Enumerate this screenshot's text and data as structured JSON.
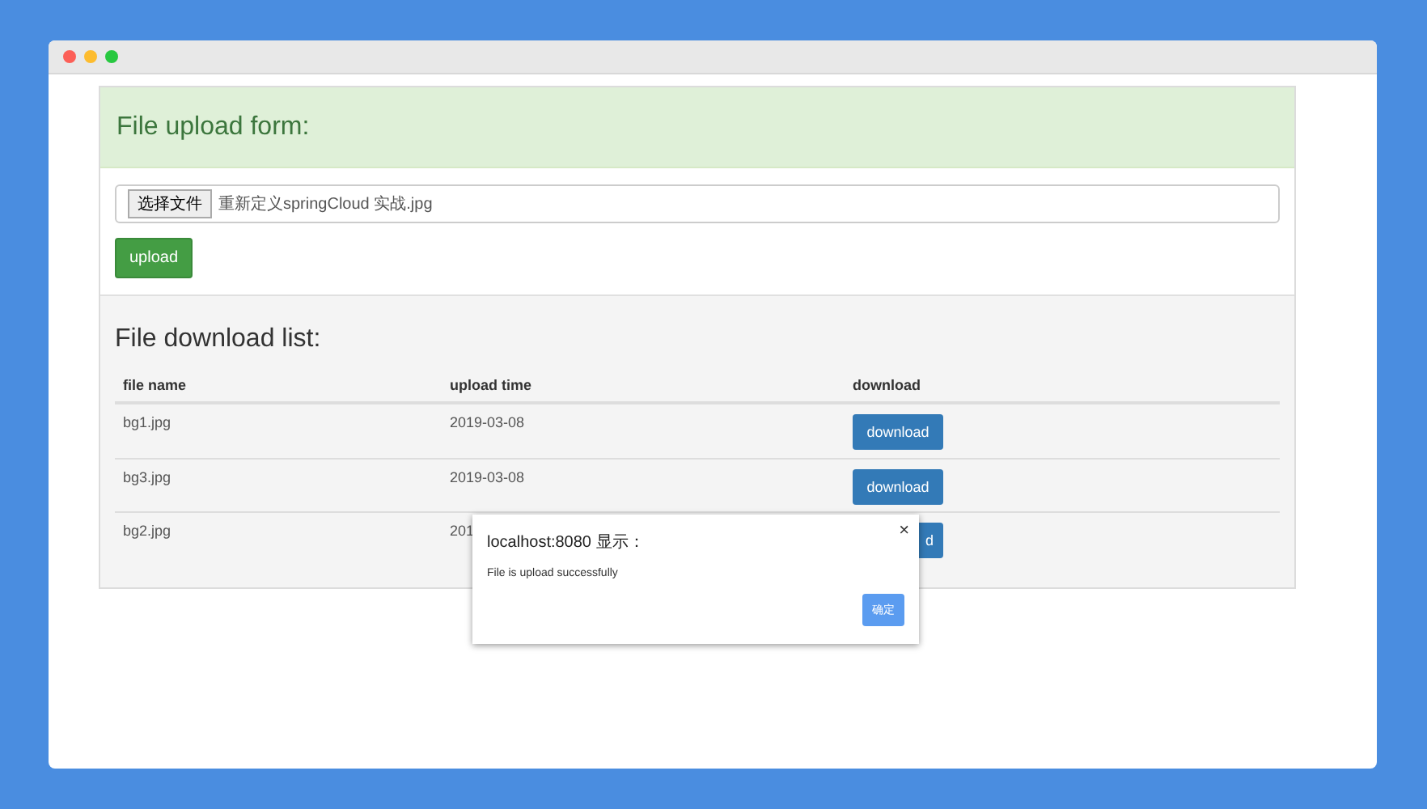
{
  "upload_panel": {
    "title": "File upload form:",
    "file_button": "选择文件",
    "file_name": "重新定义springCloud 实战.jpg",
    "upload_button": "upload"
  },
  "download_panel": {
    "title": "File download list:",
    "columns": [
      "file name",
      "upload time",
      "download"
    ],
    "rows": [
      {
        "file": "bg1.jpg",
        "time": "2019-03-08",
        "action": "download"
      },
      {
        "file": "bg3.jpg",
        "time": "2019-03-08",
        "action": "download"
      },
      {
        "file": "bg2.jpg",
        "time": "201",
        "action": "d"
      }
    ]
  },
  "dialog": {
    "title": "localhost:8080 显示：",
    "message": "File is upload successfully",
    "close": "×",
    "ok_button": "确定"
  }
}
